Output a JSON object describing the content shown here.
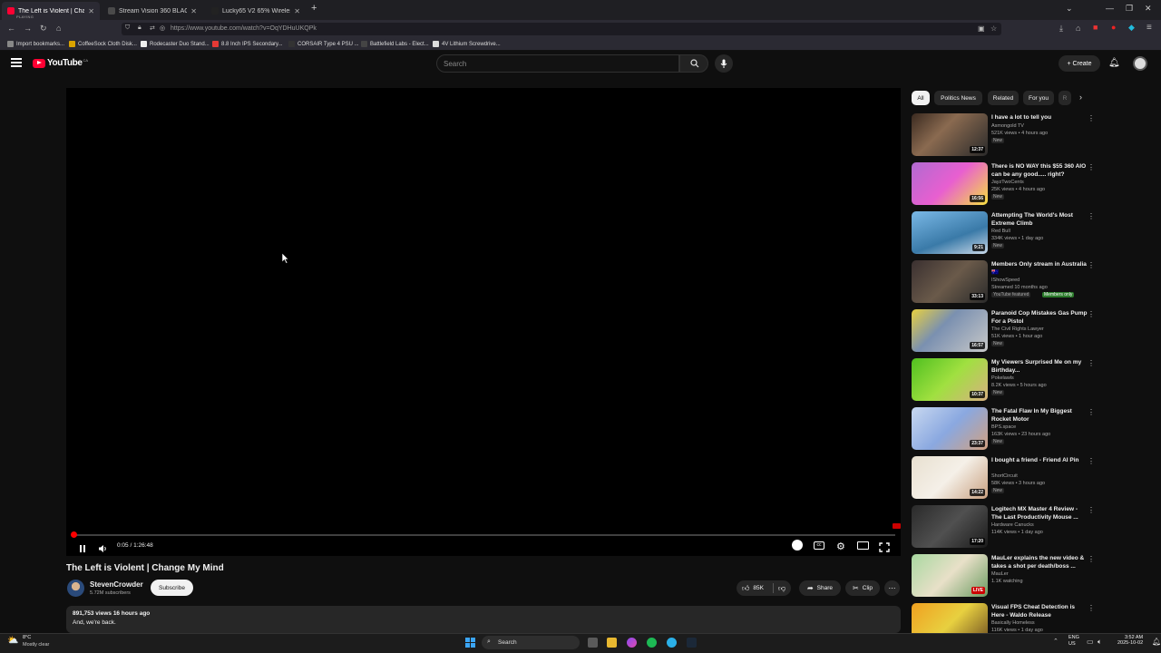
{
  "browser": {
    "tabs": [
      {
        "title": "The Left is Violent | Change My",
        "sub": "PLAYING",
        "fav": "#ff0033"
      },
      {
        "title": "Stream Vision 360 BLACK – The",
        "sub": "",
        "fav": "#4a4a4a"
      },
      {
        "title": "Lucky65 V2 65% Wireless Mech",
        "sub": "",
        "fav": "#222"
      }
    ],
    "url": "https://www.youtube.com/watch?v=OqYDHuUKQPk",
    "bookmarks": [
      {
        "label": "Import bookmarks...",
        "color": "#888"
      },
      {
        "label": "CoffeeSock Cloth Disk...",
        "color": "#d9a300"
      },
      {
        "label": "Rodecaster Duo Stand...",
        "color": "#eee"
      },
      {
        "label": "8.8 Inch IPS Secondary...",
        "color": "#e53935"
      },
      {
        "label": "CORSAIR Type 4 PSU ...",
        "color": "#333"
      },
      {
        "label": "Battlefield Labs - Elect...",
        "color": "#444"
      },
      {
        "label": "4V Lithium Screwdrive...",
        "color": "#ddd"
      }
    ]
  },
  "header": {
    "logo_text": "YouTube",
    "logo_region": "CA",
    "search_placeholder": "Search",
    "create_label": "+ Create"
  },
  "player": {
    "time": "0:05 / 1:26:48",
    "progress": 0.001
  },
  "video": {
    "title": "The Left is Violent | Change My Mind",
    "channel": "StevenCrowder",
    "subscribers": "5.72M subscribers",
    "subscribe_label": "Subscribe",
    "likes": "85K",
    "share_label": "Share",
    "clip_label": "Clip",
    "views_date": "891,753 views  16 hours ago",
    "description": "And, we're back."
  },
  "chips": [
    "All",
    "Politics News",
    "Related",
    "For you",
    "R"
  ],
  "recommendations": [
    {
      "title": "I have a lot to tell you",
      "channel": "Asmongold TV",
      "meta": "521K views • 4 hours ago",
      "badge": "New",
      "duration": "12:37",
      "thumb": "linear-gradient(135deg,#3a2a20,#8a6a50 40%,#2a2a2a)"
    },
    {
      "title": "There is NO WAY this $55 360 AIO can be any good..... right?",
      "channel": "JayzTwoCents",
      "meta": "25K views • 4 hours ago",
      "badge": "New",
      "duration": "16:56",
      "thumb": "linear-gradient(135deg,#b06ad0,#e85fd0 50%,#f5e040)"
    },
    {
      "title": "Attempting The World's Most Extreme Climb",
      "channel": "Red Bull",
      "meta": "334K views • 1 day ago",
      "badge": "New",
      "duration": "9:21",
      "thumb": "linear-gradient(160deg,#7ab8e6,#3a7aa8 60%,#c8d8e8)"
    },
    {
      "title": "Members Only stream in Australia 🇦🇺",
      "channel": "IShowSpeed",
      "meta": "Streamed 10 months ago",
      "badge": "YouTube featured",
      "badge2": "Members only",
      "duration": "33:13",
      "thumb": "linear-gradient(135deg,#3a3030,#6a5a4a 50%,#2a2a2a)"
    },
    {
      "title": "Paranoid Cop Mistakes Gas Pump For a Pistol",
      "channel": "The Civil Rights Lawyer",
      "meta": "51K views • 1 hour ago",
      "badge": "New",
      "duration": "16:57",
      "thumb": "linear-gradient(135deg,#e8d040,#7a90b0 40%,#c8c8c8)"
    },
    {
      "title": "My Viewers Surprised Me on my Birthday...",
      "channel": "Pokelawls",
      "meta": "8.2K views • 5 hours ago",
      "badge": "New",
      "duration": "10:37",
      "thumb": "linear-gradient(135deg,#50c020,#a0e040 50%,#d8b080)"
    },
    {
      "title": "The Fatal Flaw In My Biggest Rocket Motor",
      "channel": "BPS.space",
      "meta": "163K views • 23 hours ago",
      "badge": "New",
      "duration": "23:37",
      "thumb": "linear-gradient(135deg,#c8d8f0,#8aa8e0 50%,#d0a080)"
    },
    {
      "title": "I bought a friend - Friend AI Pin",
      "channel": "ShortCircuit",
      "meta": "58K views • 3 hours ago",
      "badge": "New",
      "duration": "14:22",
      "thumb": "linear-gradient(135deg,#e8e0d0,#f5f0e8 50%,#c8a080)"
    },
    {
      "title": "Logitech MX Master 4 Review - The Last Productivity Mouse ...",
      "channel": "Hardware Canucks",
      "meta": "114K views • 1 day ago",
      "badge": "",
      "duration": "17:20",
      "thumb": "linear-gradient(135deg,#2a2a2a,#505050 50%,#1a1a1a)"
    },
    {
      "title": "MauLer explains the new video & takes a shot per death/boss ...",
      "channel": "MauLer",
      "meta": "1.1K watching",
      "badge": "",
      "duration": "LIVE",
      "thumb": "linear-gradient(135deg,#a8d8a0,#e8e0c8 50%,#6a9a60)"
    },
    {
      "title": "Visual FPS Cheat Detection is Here - Waldo Release",
      "channel": "Basically Homeless",
      "meta": "116K views • 1 day ago",
      "badge": "",
      "duration": "",
      "thumb": "linear-gradient(135deg,#f0a020,#e8d040 50%,#6a4a20)"
    }
  ],
  "taskbar": {
    "weather_temp": "8°C",
    "weather_desc": "Mostly clear",
    "search_label": "Search",
    "lang1": "ENG",
    "lang2": "US",
    "time": "3:52 AM",
    "date": "2025-10-02"
  }
}
